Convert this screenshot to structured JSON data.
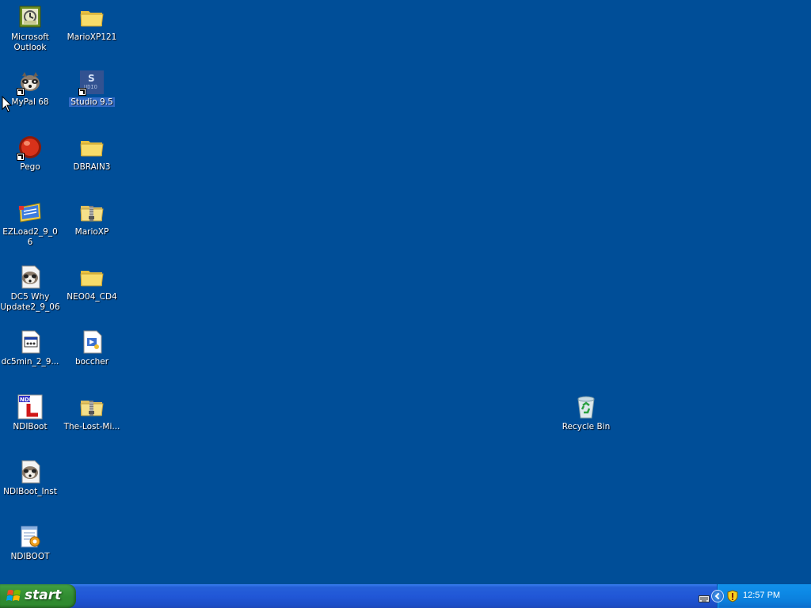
{
  "desktop": {
    "icons": [
      {
        "label": "Microsoft Outlook",
        "icon": "outlook-icon",
        "shortcut": false
      },
      {
        "label": "MarioXP121",
        "icon": "folder-icon",
        "shortcut": false
      },
      {
        "label": "MyPal 68",
        "icon": "raccoon-icon",
        "shortcut": true
      },
      {
        "label": "Studio 9.5",
        "icon": "studio-icon",
        "shortcut": true,
        "selected": true
      },
      {
        "label": "Pego",
        "icon": "pego-icon",
        "shortcut": true
      },
      {
        "label": "DBRAIN3",
        "icon": "folder-icon",
        "shortcut": false
      },
      {
        "label": "EZLoad2_9_06",
        "icon": "ezload-icon",
        "shortcut": false
      },
      {
        "label": "MarioXP",
        "icon": "zip-folder-icon",
        "shortcut": false
      },
      {
        "label": "DC5 Why Update2_9_06",
        "icon": "raccoon-doc-icon",
        "shortcut": false
      },
      {
        "label": "NEO04_CD4",
        "icon": "folder-icon",
        "shortcut": false
      },
      {
        "label": "dc5min_2_9...",
        "icon": "executable-icon",
        "shortcut": false
      },
      {
        "label": "boccher",
        "icon": "media-file-icon",
        "shortcut": false
      },
      {
        "label": "NDIBoot",
        "icon": "ndiboot-icon",
        "shortcut": false
      },
      {
        "label": "The-Lost-Mi...",
        "icon": "zip-folder-icon",
        "shortcut": false
      },
      {
        "label": "NDIBoot_Inst",
        "icon": "raccoon-doc-icon",
        "shortcut": false
      },
      {
        "label": "NDIBOOT",
        "icon": "notepad-gear-icon",
        "shortcut": false
      },
      {
        "label": "Recycle Bin",
        "icon": "recycle-bin-icon",
        "shortcut": false
      }
    ]
  },
  "taskbar": {
    "start_label": "start",
    "clock": "12:57 PM"
  },
  "colors": {
    "desktop_background": "#004e98",
    "taskbar_blue": "#245edb",
    "start_green": "#3c9a3c",
    "tray_blue": "#0f8ae6"
  }
}
